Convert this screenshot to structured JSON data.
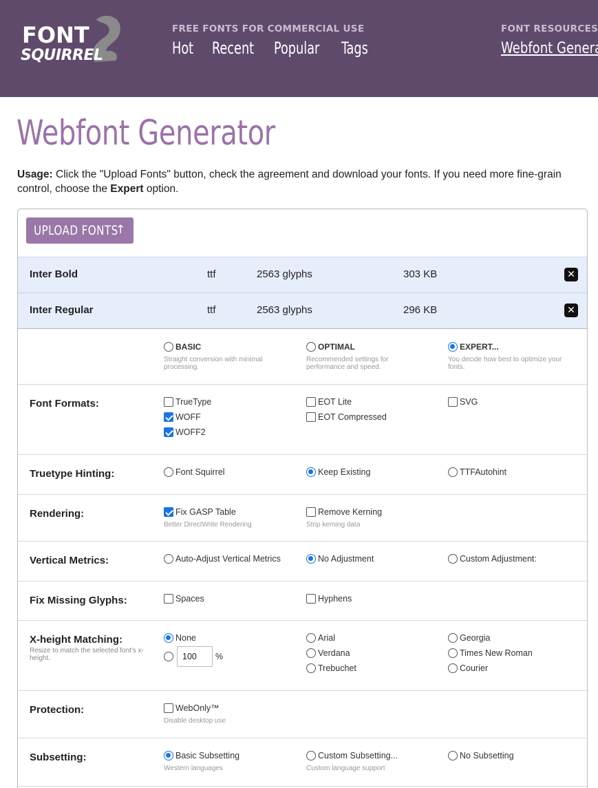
{
  "header": {
    "logo": {
      "line1": "FONT",
      "line2": "SQUIRREL"
    },
    "left_sub": "FREE FONTS FOR COMMERCIAL USE",
    "nav": [
      "Hot",
      "Recent",
      "Popular",
      "Tags"
    ],
    "right_sub": "FONT RESOURCES &",
    "right_link": "Webfont Generator",
    "bg_color": "#5f4a6c"
  },
  "title": "Webfont Generator",
  "usage": {
    "label": "Usage:",
    "text1": " Click the \"Upload Fonts\" button, check the agreement and download your fonts. If you need more fine-grain control, choose the ",
    "expert": "Expert",
    "text2": " option."
  },
  "upload": {
    "label": "UPLOAD FONTS",
    "icon": "arrow-up-icon"
  },
  "files": [
    {
      "name": "Inter Bold",
      "type": "ttf",
      "glyphs": "2563 glyphs",
      "size": "303 KB"
    },
    {
      "name": "Inter Regular",
      "type": "ttf",
      "glyphs": "2563 glyphs",
      "size": "296 KB"
    }
  ],
  "modes": [
    {
      "label": "BASIC",
      "desc": "Straight conversion with minimal processing.",
      "selected": false
    },
    {
      "label": "OPTIMAL",
      "desc": "Recommended settings for performance and speed.",
      "selected": false
    },
    {
      "label": "EXPERT...",
      "desc": "You decide how best to optimize your fonts.",
      "selected": true
    }
  ],
  "font_formats": {
    "label": "Font Formats:",
    "options": [
      {
        "label": "TrueType",
        "checked": false
      },
      {
        "label": "WOFF",
        "checked": true
      },
      {
        "label": "WOFF2",
        "checked": true
      },
      {
        "label": "EOT Lite",
        "checked": false
      },
      {
        "label": "EOT Compressed",
        "checked": false
      },
      {
        "label": "SVG",
        "checked": false
      }
    ]
  },
  "hinting": {
    "label": "Truetype Hinting:",
    "options": [
      {
        "label": "Font Squirrel",
        "selected": false
      },
      {
        "label": "Keep Existing",
        "selected": true
      },
      {
        "label": "TTFAutohint",
        "selected": false
      }
    ]
  },
  "rendering": {
    "label": "Rendering:",
    "options": [
      {
        "label": "Fix GASP Table",
        "desc": "Better DirectWrite Rendering",
        "checked": true
      },
      {
        "label": "Remove Kerning",
        "desc": "Strip kerning data",
        "checked": false
      }
    ]
  },
  "vertical_metrics": {
    "label": "Vertical Metrics:",
    "options": [
      {
        "label": "Auto-Adjust Vertical Metrics",
        "selected": false
      },
      {
        "label": "No Adjustment",
        "selected": true
      },
      {
        "label": "Custom Adjustment:",
        "selected": false
      }
    ]
  },
  "missing_glyphs": {
    "label": "Fix Missing Glyphs:",
    "options": [
      {
        "label": "Spaces",
        "checked": false
      },
      {
        "label": "Hyphens",
        "checked": false
      }
    ]
  },
  "xheight": {
    "label": "X-height Matching:",
    "sublabel": "Resize to match the selected font's x-height.",
    "none_label": "None",
    "value": "100",
    "unit": "%",
    "fonts": [
      {
        "label": "Arial",
        "selected": false
      },
      {
        "label": "Verdana",
        "selected": false
      },
      {
        "label": "Trebuchet",
        "selected": false
      },
      {
        "label": "Georgia",
        "selected": false
      },
      {
        "label": "Times New Roman",
        "selected": false
      },
      {
        "label": "Courier",
        "selected": false
      }
    ]
  },
  "protection": {
    "label": "Protection:",
    "option": {
      "label": "WebOnly™",
      "desc": "Disable desktop use",
      "checked": false
    }
  },
  "subsetting": {
    "label": "Subsetting:",
    "options": [
      {
        "label": "Basic Subsetting",
        "desc": "Western languages",
        "selected": true
      },
      {
        "label": "Custom Subsetting...",
        "desc": "Custom language support",
        "selected": false
      },
      {
        "label": "No Subsetting",
        "desc": "",
        "selected": false
      }
    ]
  }
}
